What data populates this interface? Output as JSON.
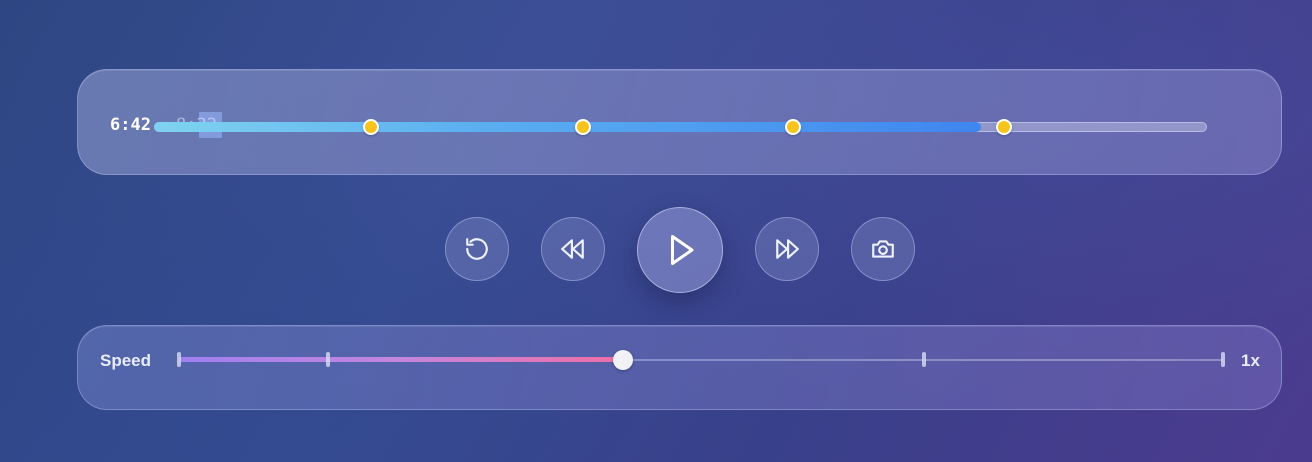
{
  "timeline": {
    "current_time": "6:42",
    "total_time": "8:22",
    "progress": 0.785,
    "markers": [
      0.206,
      0.407,
      0.607,
      0.807
    ]
  },
  "controls": {
    "buttons": [
      {
        "name": "replay-button",
        "icon": "rotate-ccw-icon"
      },
      {
        "name": "rewind-button",
        "icon": "rewind-icon"
      },
      {
        "name": "play-button",
        "icon": "play-icon"
      },
      {
        "name": "fast-forward-button",
        "icon": "fast-forward-icon"
      },
      {
        "name": "screenshot-button",
        "icon": "camera-icon"
      }
    ]
  },
  "speed": {
    "label": "Speed",
    "value": "1x",
    "level": 0.425,
    "ticks": [
      0,
      0.143,
      0.429,
      0.714,
      1
    ]
  },
  "colors": {
    "progress_start": "#7fd3ef",
    "progress_end": "#3f86f0",
    "marker": "#f7c41c",
    "speed_start": "#a07ff0",
    "speed_end": "#ee6fa6"
  }
}
